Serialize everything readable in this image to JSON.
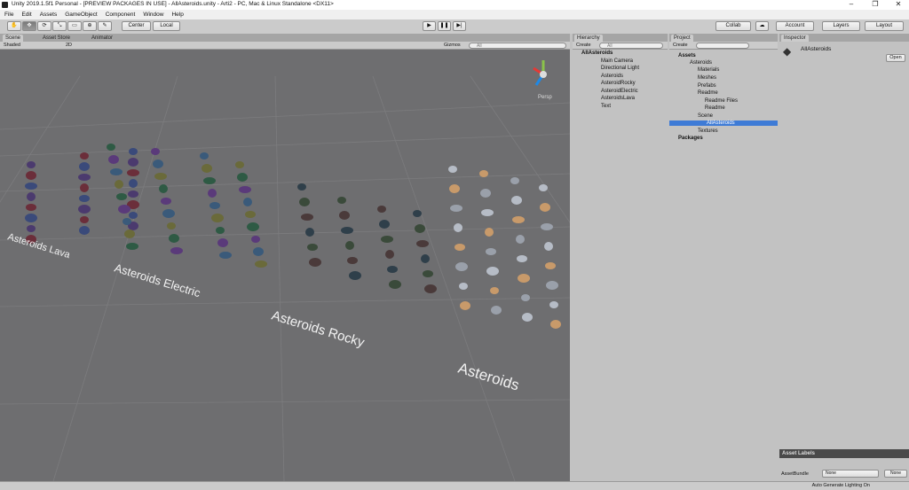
{
  "window": {
    "title": "Unity 2019.1.5f1 Personal - [PREVIEW PACKAGES IN USE] - AllAsteroids.unity - Arti2 - PC, Mac & Linux Standalone <DX11>",
    "minimize": "–",
    "maximize": "❐",
    "close": "✕"
  },
  "menu": [
    "File",
    "Edit",
    "Assets",
    "GameObject",
    "Component",
    "Window",
    "Help"
  ],
  "toolbar": {
    "tools": [
      "✋",
      "✥",
      "⟳",
      "⤡",
      "▭",
      "⊕",
      "✎"
    ],
    "pivot": "Center",
    "space": "Local",
    "play": "▶",
    "pause": "❚❚",
    "step": "▶|",
    "collab": "Collab",
    "account": "Account",
    "layers": "Layers",
    "layout": "Layout"
  },
  "scene": {
    "tabs": [
      "Scene",
      "Asset Store",
      "Animator"
    ],
    "shading": "Shaded",
    "mode2d": "2D",
    "gizmos": "Gizmos",
    "all": "All",
    "persp": "Persp",
    "labels": [
      "Asteroids Lava",
      "Asteroids Electric",
      "Asteroids Rocky",
      "Asteroids"
    ]
  },
  "hierarchy": {
    "tab": "Hierarchy",
    "create": "Create",
    "search": "All",
    "root": "AllAsteroids",
    "items": [
      "Main Camera",
      "Directional Light",
      "Asteroids",
      "AsteroidRocky",
      "AsteroidElectric",
      "AsteroidsLava",
      "Text"
    ]
  },
  "project": {
    "tab": "Project",
    "create": "Create",
    "items": [
      "Assets",
      "Asteroids",
      "Materials",
      "Meshes",
      "Prefabs",
      "Readme",
      "Readme Files",
      "Readme",
      "Scene",
      "AllAsteroids",
      "Textures",
      "Packages"
    ]
  },
  "inspector": {
    "tab": "Inspector",
    "asset": "AllAsteroids",
    "open": "Open",
    "asset_labels": "Asset Labels",
    "asset_bundle": "AssetBundle",
    "bundle_value": "None",
    "variant_value": "None"
  },
  "status": "Auto Generate Lighting On",
  "colors": {
    "scene_bg": "#6e6e70",
    "panel_bg": "#c2c2c2",
    "selected": "#3e7bd6"
  }
}
